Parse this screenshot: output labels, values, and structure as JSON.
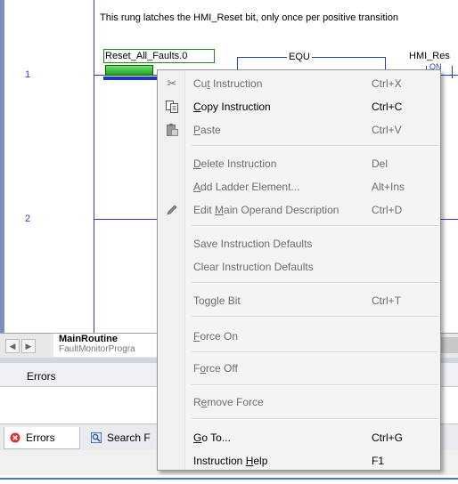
{
  "ladder": {
    "comment": "This rung latches the HMI_Reset bit, only once per positive transition",
    "rung_numbers": [
      "1",
      "2"
    ],
    "contact_tag": "Reset_All_Faults.0",
    "equ_label": "EQU",
    "output_tag": "HMI_Res",
    "output_sub": "ON"
  },
  "routine_tab": {
    "title": "MainRoutine",
    "subtitle": "FaultMonitorProgra"
  },
  "errors_pane": {
    "title": "Errors",
    "tabs": [
      {
        "label": "Errors",
        "icon": "error-icon"
      },
      {
        "label": "Search F",
        "icon": "search-results-icon"
      }
    ]
  },
  "context_menu": {
    "items": [
      {
        "label": "Cut Instruction",
        "ul": "t",
        "shortcut": "Ctrl+X",
        "icon": "scissors-icon",
        "enabled": false
      },
      {
        "label": "Copy Instruction",
        "ul": "C",
        "shortcut": "Ctrl+C",
        "icon": "copy-icon",
        "enabled": true
      },
      {
        "label": "Paste",
        "ul": "P",
        "shortcut": "Ctrl+V",
        "icon": "paste-icon",
        "enabled": false
      },
      {
        "label": "Delete Instruction",
        "ul": "D",
        "shortcut": "Del",
        "enabled": false
      },
      {
        "label": "Add Ladder Element...",
        "ul": "A",
        "shortcut": "Alt+Ins",
        "enabled": false
      },
      {
        "label": "Edit Main Operand Description",
        "ul": "M",
        "shortcut": "Ctrl+D",
        "icon": "pencil-icon",
        "enabled": false
      },
      {
        "label": "Save Instruction Defaults",
        "shortcut": "",
        "enabled": false
      },
      {
        "label": "Clear Instruction Defaults",
        "shortcut": "",
        "enabled": false
      },
      {
        "label": "Toggle Bit",
        "shortcut": "Ctrl+T",
        "enabled": false
      },
      {
        "label": "Force On",
        "ul": "F",
        "shortcut": "",
        "enabled": false
      },
      {
        "label": "Force Off",
        "ul": "o",
        "shortcut": "",
        "enabled": false
      },
      {
        "label": "Remove Force",
        "ul": "e",
        "shortcut": "",
        "enabled": false
      },
      {
        "label": "Go To...",
        "ul": "G",
        "shortcut": "Ctrl+G",
        "enabled": true
      },
      {
        "label": "Instruction Help",
        "ul": "H",
        "shortcut": "F1",
        "enabled": true
      }
    ]
  }
}
